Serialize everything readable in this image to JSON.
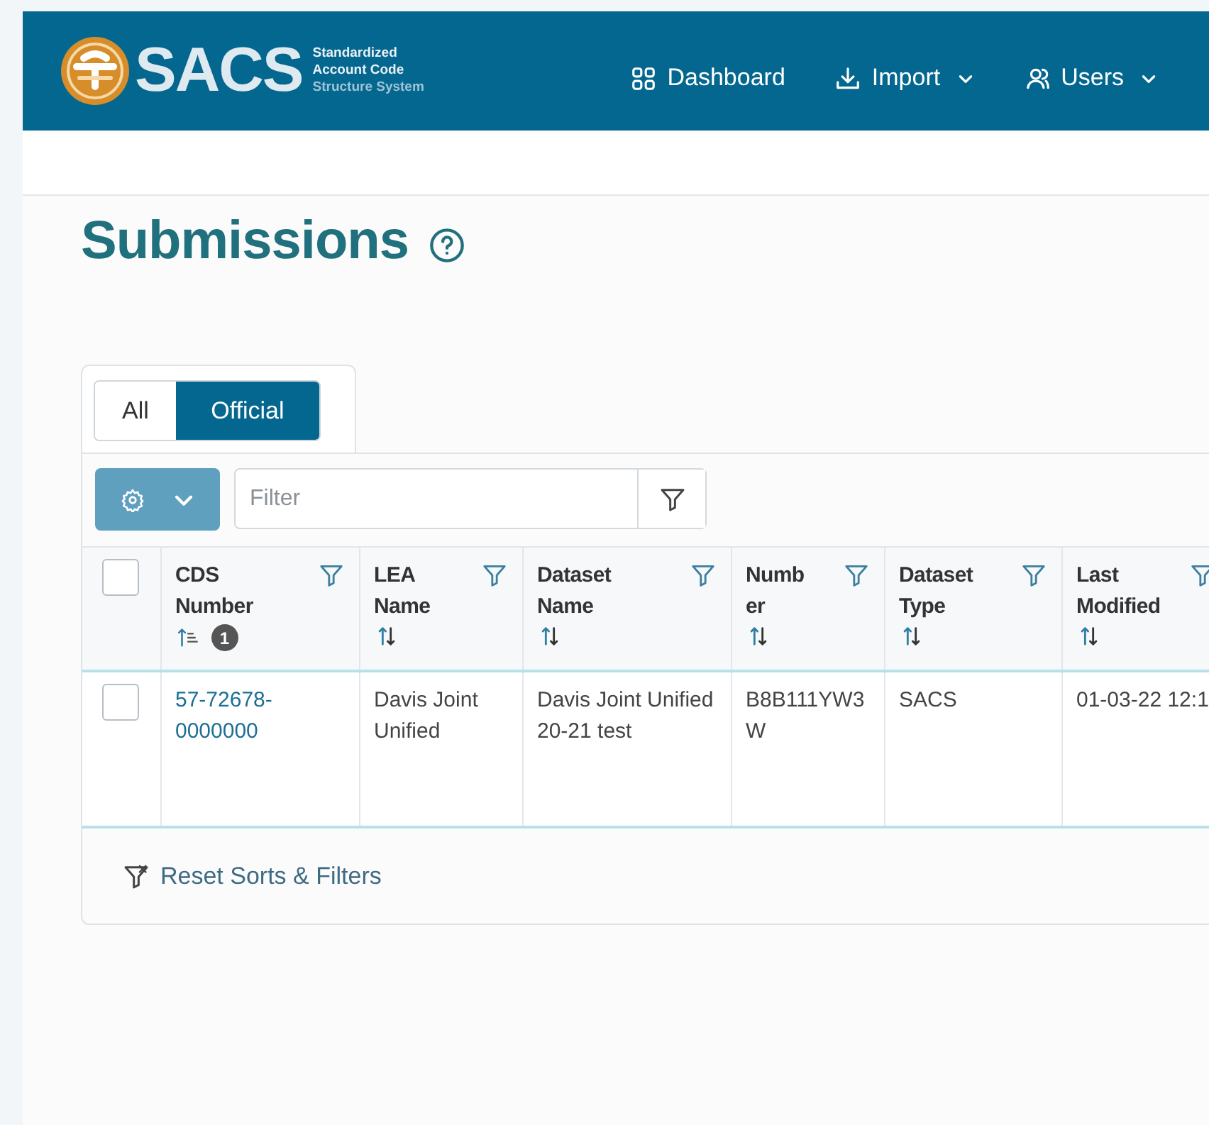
{
  "header": {
    "logo": "SACS",
    "tagline": [
      "Standardized",
      "Account Code",
      "Structure System"
    ],
    "nav": [
      {
        "label": "Dashboard",
        "dropdown": false
      },
      {
        "label": "Import",
        "dropdown": true
      },
      {
        "label": "Users",
        "dropdown": true
      }
    ]
  },
  "page": {
    "title": "Submissions"
  },
  "tabs": [
    {
      "label": "All",
      "selected": false
    },
    {
      "label": "Official",
      "selected": true
    }
  ],
  "toolbar": {
    "filter": {
      "placeholder": "Filter"
    }
  },
  "table": {
    "select_all": {
      "checked": false
    },
    "columns": [
      {
        "label": "CDS Number",
        "sorted": true,
        "sort_order": "1"
      },
      {
        "label": "LEA Name",
        "sorted": false
      },
      {
        "label": "Dataset Name",
        "sorted": false
      },
      {
        "label": "Number",
        "sorted": false
      },
      {
        "label": "Dataset Type",
        "sorted": false
      },
      {
        "label": "Last Modified",
        "sorted": false
      }
    ],
    "rows": [
      {
        "checked": false,
        "cells": [
          {
            "text": "57-72678-0000000",
            "kind": "link"
          },
          {
            "text": "Davis Joint Unified",
            "kind": "text"
          },
          {
            "text": "Davis Joint Unified 20-21 test",
            "kind": "text"
          },
          {
            "text": "B8B111YW3W",
            "kind": "text"
          },
          {
            "text": "SACS",
            "kind": "text"
          },
          {
            "text": "01-03-22 12:1",
            "kind": "text"
          }
        ]
      }
    ]
  },
  "footer": {
    "reset": "Reset Sorts & Filters"
  }
}
